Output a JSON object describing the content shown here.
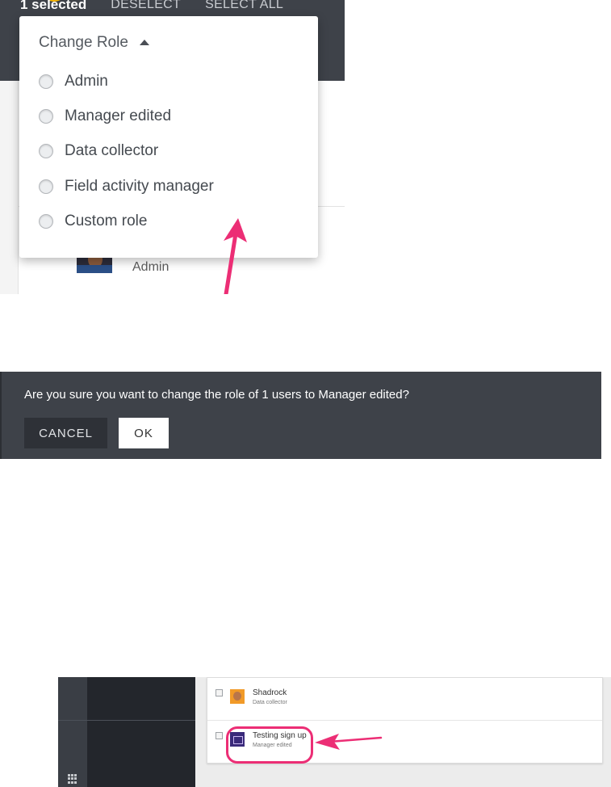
{
  "selection_bar": {
    "count_label": "1 selected",
    "deselect_label": "DESELECT",
    "select_all_label": "SELECT ALL"
  },
  "change_role_menu": {
    "title": "Change Role",
    "options": [
      {
        "label": "Admin",
        "selected": false
      },
      {
        "label": "Manager edited",
        "selected": false
      },
      {
        "label": "Data collector",
        "selected": false
      },
      {
        "label": "Field activity manager",
        "selected": false
      },
      {
        "label": "Custom role",
        "selected": false
      }
    ]
  },
  "background_user": {
    "role": "Admin"
  },
  "confirm_dialog": {
    "message": "Are you sure you want to change the role of 1 users to Manager edited?",
    "cancel_label": "CANCEL",
    "ok_label": "OK"
  },
  "users_list": [
    {
      "name": "Shadrock",
      "role": "Data collector"
    },
    {
      "name": "Testing sign up",
      "role": "Manager edited"
    }
  ],
  "colors": {
    "header_dark": "#3e4249",
    "accent_yellow": "#f6b400",
    "annotation_pink": "#ec2e75"
  }
}
